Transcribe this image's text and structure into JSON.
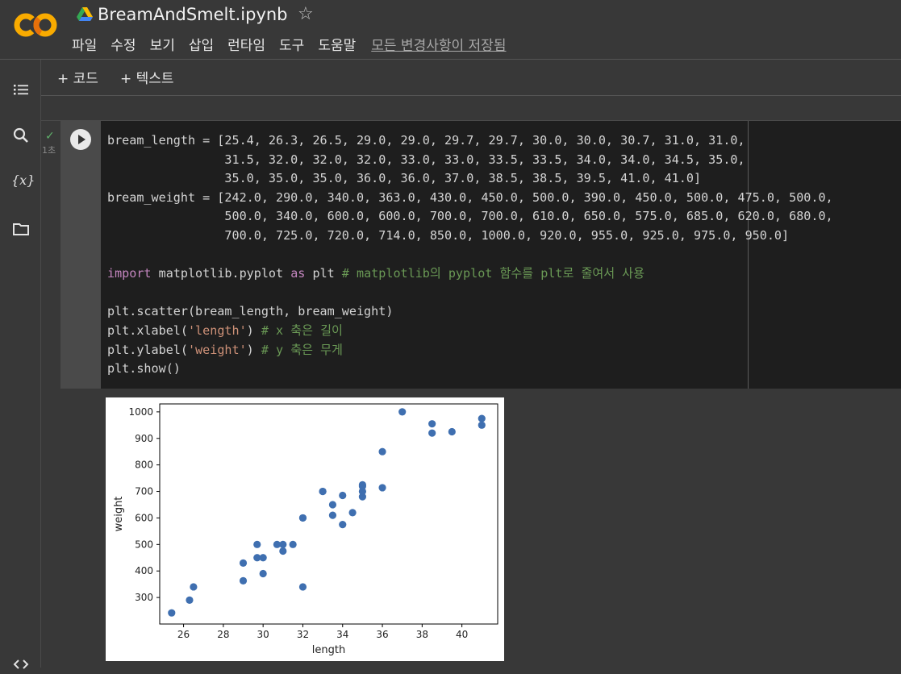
{
  "header": {
    "logo_text": "CO",
    "title": "BreamAndSmelt.ipynb",
    "star_icon": "star-outline-icon",
    "menu": [
      "파일",
      "수정",
      "보기",
      "삽입",
      "런타임",
      "도구",
      "도움말"
    ],
    "save_status": "모든 변경사항이 저장됨"
  },
  "sidebar": {
    "icons": [
      "table-of-contents-icon",
      "search-icon",
      "variables-icon",
      "folder-icon",
      "code-snippets-icon"
    ],
    "variables_label": "{x}"
  },
  "toolbar": {
    "add_code": "+ 코드",
    "add_text": "+ 텍스트"
  },
  "cell": {
    "status": "✓",
    "exec_time": "1초",
    "code_lines": [
      "bream_length = [25.4, 26.3, 26.5, 29.0, 29.0, 29.7, 29.7, 30.0, 30.0, 30.7, 31.0, 31.0,",
      "                31.5, 32.0, 32.0, 32.0, 33.0, 33.0, 33.5, 33.5, 34.0, 34.0, 34.5, 35.0,",
      "                35.0, 35.0, 35.0, 36.0, 36.0, 37.0, 38.5, 38.5, 39.5, 41.0, 41.0]",
      "bream_weight = [242.0, 290.0, 340.0, 363.0, 430.0, 450.0, 500.0, 390.0, 450.0, 500.0, 475.0, 500.0,",
      "                500.0, 340.0, 600.0, 600.0, 700.0, 700.0, 610.0, 650.0, 575.0, 685.0, 620.0, 680.0,",
      "                700.0, 725.0, 720.0, 714.0, 850.0, 1000.0, 920.0, 955.0, 925.0, 975.0, 950.0]",
      "",
      "import matplotlib.pyplot as plt # matplotlib의 pyplot 함수를 plt로 줄여서 사용",
      "",
      "plt.scatter(bream_length, bream_weight)",
      "plt.xlabel('length') # x 축은 길이",
      "plt.ylabel('weight') # y 축은 무게",
      "plt.show()"
    ]
  },
  "colors": {
    "background": "#383838",
    "code_bg": "#1e1e1e",
    "keyword": "#c586c0",
    "comment": "#6a9955",
    "string": "#ce9178",
    "marker": "#3f6fb0",
    "logo_orange": "#f9ab00",
    "logo_dark": "#e8710a"
  },
  "chart_data": {
    "type": "scatter",
    "xlabel": "length",
    "ylabel": "weight",
    "xlim": [
      24.8,
      41.8
    ],
    "ylim": [
      200,
      1030
    ],
    "xticks": [
      26,
      28,
      30,
      32,
      34,
      36,
      38,
      40
    ],
    "yticks": [
      300,
      400,
      500,
      600,
      700,
      800,
      900,
      1000
    ],
    "grid": false,
    "x": [
      25.4,
      26.3,
      26.5,
      29.0,
      29.0,
      29.7,
      29.7,
      30.0,
      30.0,
      30.7,
      31.0,
      31.0,
      31.5,
      32.0,
      32.0,
      32.0,
      33.0,
      33.0,
      33.5,
      33.5,
      34.0,
      34.0,
      34.5,
      35.0,
      35.0,
      35.0,
      35.0,
      36.0,
      36.0,
      37.0,
      38.5,
      38.5,
      39.5,
      41.0,
      41.0
    ],
    "y": [
      242.0,
      290.0,
      340.0,
      363.0,
      430.0,
      450.0,
      500.0,
      390.0,
      450.0,
      500.0,
      475.0,
      500.0,
      500.0,
      340.0,
      600.0,
      600.0,
      700.0,
      700.0,
      610.0,
      650.0,
      575.0,
      685.0,
      620.0,
      680.0,
      700.0,
      725.0,
      720.0,
      714.0,
      850.0,
      1000.0,
      920.0,
      955.0,
      925.0,
      975.0,
      950.0
    ]
  }
}
